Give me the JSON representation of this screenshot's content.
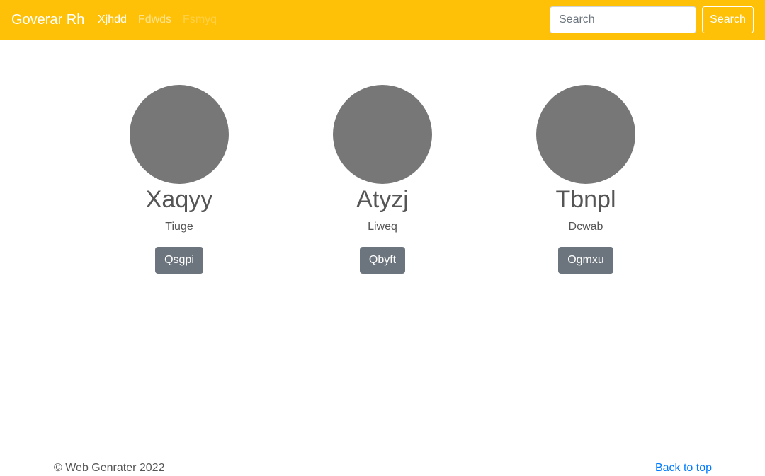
{
  "navbar": {
    "brand": "Goverar Rh",
    "links": [
      {
        "label": "Xjhdd",
        "state": "active"
      },
      {
        "label": "Fdwds",
        "state": "muted"
      },
      {
        "label": "Fsmyq",
        "state": "disabled"
      }
    ],
    "search": {
      "placeholder": "Search",
      "button_label": "Search"
    }
  },
  "people": [
    {
      "name": "Xaqyy",
      "role": "Tiuge",
      "button_label": "Qsgpi"
    },
    {
      "name": "Atyzj",
      "role": "Liweq",
      "button_label": "Qbyft"
    },
    {
      "name": "Tbnpl",
      "role": "Dcwab",
      "button_label": "Ogmxu"
    }
  ],
  "footer": {
    "copyright": "© Web Genrater 2022",
    "back_to_top": "Back to top"
  },
  "colors": {
    "navbar_bg": "#ffc107",
    "avatar_bg": "#777777",
    "button_bg": "#6c757d",
    "link": "#007bff"
  }
}
